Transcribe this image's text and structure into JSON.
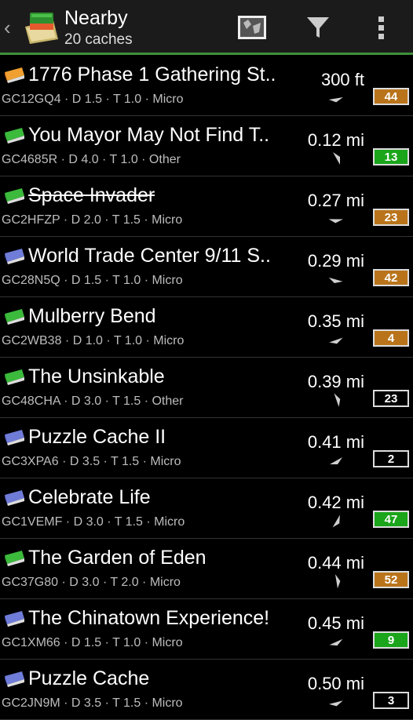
{
  "header": {
    "title": "Nearby",
    "subtitle": "20 caches",
    "icons": [
      "back-chevron-icon",
      "app-logo-icon",
      "map-icon",
      "filter-icon",
      "overflow-menu-icon"
    ]
  },
  "colors": {
    "accent": "#3f8f3a",
    "badge_orange": "#b9741b",
    "badge_green": "#1aa51a",
    "badge_black": "#000000"
  },
  "caches": [
    {
      "name": "1776 Phase 1 Gathering St..",
      "meta": "GC12GQ4 · D 1.5 · T 1.0 · Micro",
      "distance": "300 ft",
      "badge": "44",
      "badge_color": "orange",
      "icon": "orange",
      "archived": false
    },
    {
      "name": "You Mayor May Not Find T..",
      "meta": "GC4685R · D 4.0 · T 1.0 · Other",
      "distance": "0.12 mi",
      "badge": "13",
      "badge_color": "green",
      "icon": "green",
      "archived": false
    },
    {
      "name": "Space Invader",
      "meta": "GC2HFZP · D 2.0 · T 1.5 · Micro",
      "distance": "0.27 mi",
      "badge": "23",
      "badge_color": "orange",
      "icon": "green",
      "archived": true
    },
    {
      "name": "World Trade Center 9/11 S..",
      "meta": "GC28N5Q · D 1.5 · T 1.0 · Micro",
      "distance": "0.29 mi",
      "badge": "42",
      "badge_color": "orange",
      "icon": "blue",
      "archived": false
    },
    {
      "name": "Mulberry Bend",
      "meta": "GC2WB38 · D 1.0 · T 1.0 · Micro",
      "distance": "0.35 mi",
      "badge": "4",
      "badge_color": "orange",
      "icon": "green",
      "archived": false
    },
    {
      "name": "The Unsinkable",
      "meta": "GC48CHA · D 3.0 · T 1.5 · Other",
      "distance": "0.39 mi",
      "badge": "23",
      "badge_color": "black",
      "icon": "green",
      "archived": false
    },
    {
      "name": "Puzzle Cache II",
      "meta": "GC3XPA6 · D 3.5 · T 1.5 · Micro",
      "distance": "0.41 mi",
      "badge": "2",
      "badge_color": "black",
      "icon": "blue",
      "archived": false
    },
    {
      "name": "Celebrate Life",
      "meta": "GC1VEMF · D 3.0 · T 1.5 · Micro",
      "distance": "0.42 mi",
      "badge": "47",
      "badge_color": "green",
      "icon": "blue",
      "archived": false
    },
    {
      "name": "The Garden of Eden",
      "meta": "GC37G80 · D 3.0 · T 2.0 · Micro",
      "distance": "0.44 mi",
      "badge": "52",
      "badge_color": "orange",
      "icon": "green",
      "archived": false
    },
    {
      "name": "The Chinatown Experience!",
      "meta": "GC1XM66 · D 1.5 · T 1.0 · Micro",
      "distance": "0.45 mi",
      "badge": "9",
      "badge_color": "green",
      "icon": "blue",
      "archived": false
    },
    {
      "name": "Puzzle Cache",
      "meta": "GC2JN9M · D 3.5 · T 1.5 · Micro",
      "distance": "0.50 mi",
      "badge": "3",
      "badge_color": "black",
      "icon": "blue",
      "archived": false
    }
  ]
}
